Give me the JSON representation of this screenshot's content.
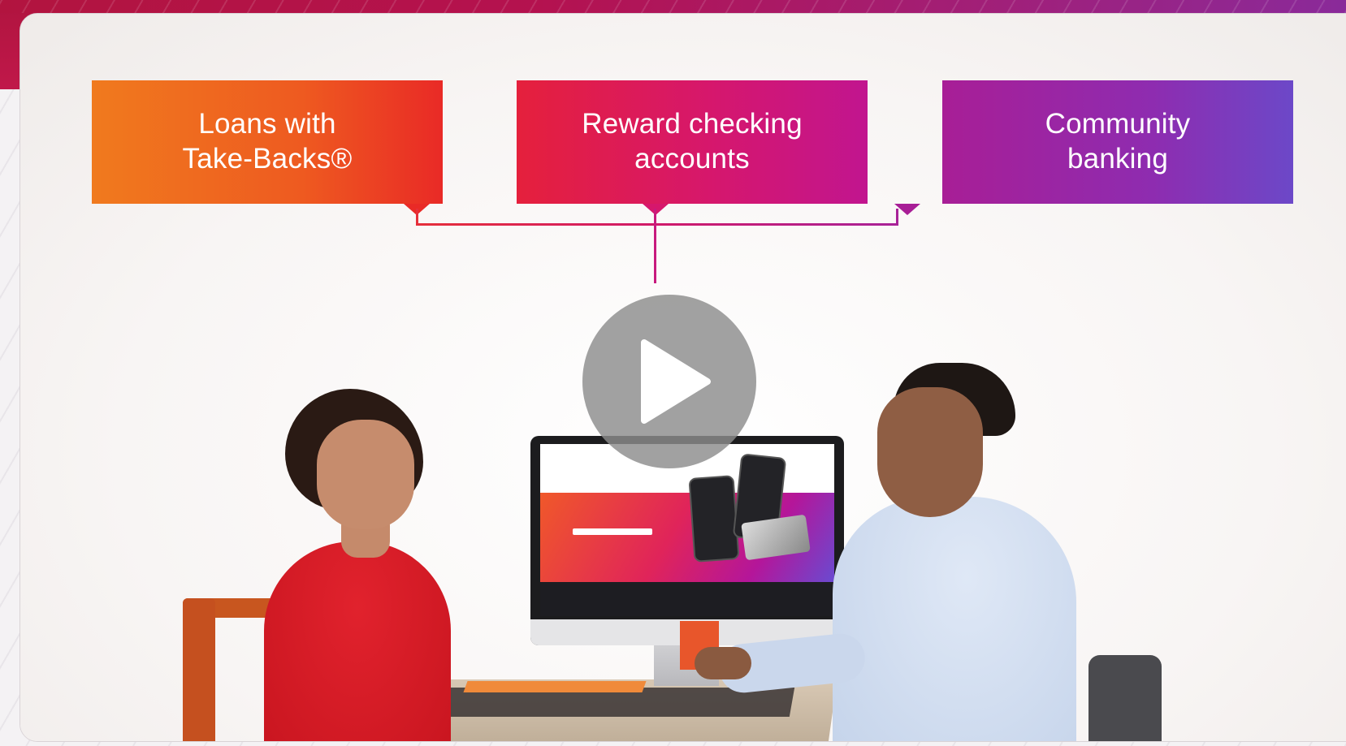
{
  "features": [
    {
      "label": "Loans with\nTake-Backs®"
    },
    {
      "label": "Reward checking\naccounts"
    },
    {
      "label": "Community\nbanking"
    }
  ],
  "colors": {
    "feature_1": "#ee5a20",
    "feature_2": "#d6176c",
    "feature_3": "#8e2cb0",
    "connector": "#d81f57",
    "play_button": "#8c8c8c"
  },
  "icons": {
    "play": "play-icon"
  }
}
